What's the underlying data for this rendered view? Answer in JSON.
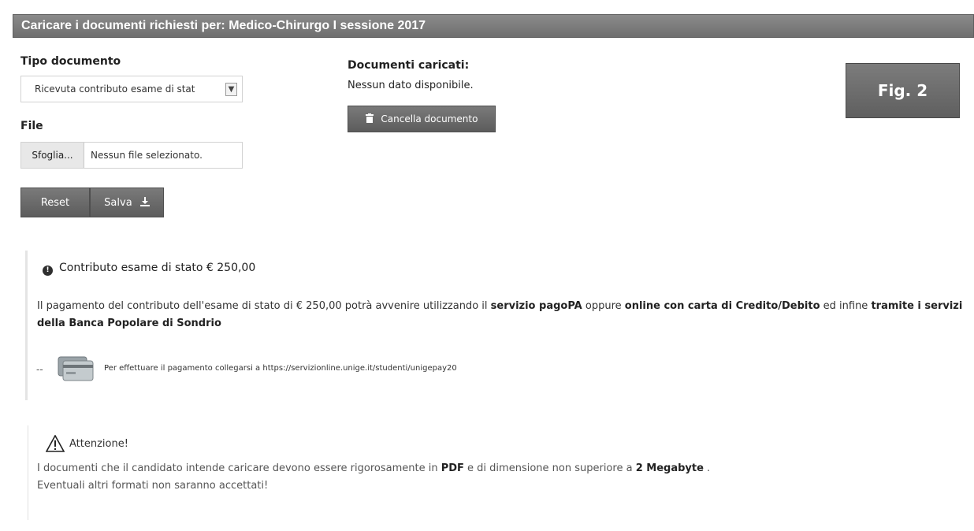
{
  "header": {
    "title": "Caricare i documenti richiesti per: Medico-Chirurgo I sessione 2017"
  },
  "form": {
    "tipo_label": "Tipo documento",
    "tipo_selected": "Ricevuta contributo esame di stat",
    "file_label": "File",
    "browse_label": "Sfoglia...",
    "file_status": "Nessun file selezionato.",
    "reset_label": "Reset",
    "save_label": "Salva"
  },
  "documents": {
    "title": "Documenti caricati:",
    "empty_text": "Nessun dato disponibile.",
    "delete_label": "Cancella documento"
  },
  "fig_label": "Fig. 2",
  "contributo": {
    "title": "Contributo esame di stato € 250,00",
    "text_1": "Il pagamento del contributo dell'esame di stato di € 250,00 potrà avvenire utilizzando il ",
    "bold_1": "servizio pagoPA",
    "text_2": " oppure ",
    "bold_2": "online con carta di Credito/Debito",
    "text_3": " ed infine ",
    "bold_3": "tramite i servizi della Banca Popolare di Sondrio",
    "pay_dash": "--",
    "pay_text": "Per effettuare il pagamento collegarsi a https://servizionline.unige.it/studenti/unigepay20"
  },
  "attenzione": {
    "title": "Attenzione!",
    "text_1": "I documenti che il candidato intende caricare devono essere rigorosamente in ",
    "bold_1": "PDF",
    "text_2": " e di dimensione non superiore a ",
    "bold_2": "2 Megabyte",
    "text_3": " .",
    "text_4": "Eventuali altri formati non saranno accettati!"
  },
  "colors": {
    "header_bg": "#7d7d7d",
    "button_bg": "#6a6a6a",
    "text": "#333333"
  },
  "icons": {
    "info": "info-circle-icon",
    "trash": "trash-icon",
    "download": "download-icon",
    "warning": "warning-triangle-icon",
    "cards": "credit-cards-icon"
  }
}
